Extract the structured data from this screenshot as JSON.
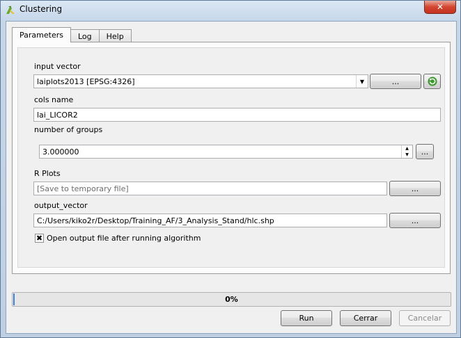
{
  "window": {
    "title": "Clustering",
    "close_label": "✕"
  },
  "tabs": [
    {
      "label": "Parameters"
    },
    {
      "label": "Log"
    },
    {
      "label": "Help"
    }
  ],
  "form": {
    "input_vector": {
      "label": "input vector",
      "value": "laiplots2013 [EPSG:4326]",
      "browse_label": "..."
    },
    "cols_name": {
      "label": "cols name",
      "value": "lai_LICOR2"
    },
    "number_of_groups": {
      "label": "number of groups",
      "value": "3.000000",
      "button_label": "..."
    },
    "r_plots": {
      "label": "R Plots",
      "placeholder": "[Save to temporary file]",
      "browse_label": "..."
    },
    "output_vector": {
      "label": "output_vector",
      "value": "C:/Users/kiko2r/Desktop/Training_AF/3_Analysis_Stand/hlc.shp",
      "browse_label": "..."
    },
    "open_output": {
      "label": "Open output file after running algorithm",
      "checked": true,
      "mark": "✖"
    }
  },
  "progress": {
    "value": 0,
    "text": "0%"
  },
  "buttons": {
    "run": "Run",
    "close": "Cerrar",
    "cancel": "Cancelar"
  },
  "colors": {
    "progress_fill": "#3f7fd9",
    "close_button": "#c23420",
    "refresh_icon": "#3d9a2f"
  },
  "icons": {
    "app": "qgis-icon",
    "refresh": "refresh-icon",
    "dropdown": "chevron-down-icon"
  }
}
